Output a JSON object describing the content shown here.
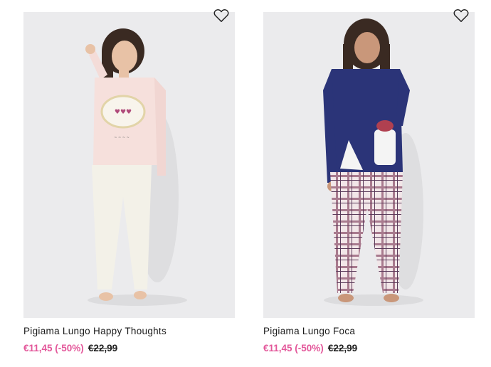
{
  "colors": {
    "sale_price": "#e3579a",
    "text": "#1a1a1a",
    "photo_bg": "#ebebed"
  },
  "products": [
    {
      "name": "Pigiama Lungo Happy Thoughts",
      "sale_price": "€11,45 (-50%)",
      "original_price": "€22,99",
      "wishlist_icon": "heart-outline-icon",
      "photo_alt": "pink pajama top with cloud and hearts, cream trousers"
    },
    {
      "name": "Pigiama Lungo Foca",
      "sale_price": "€11,45 (-50%)",
      "original_price": "€22,99",
      "wishlist_icon": "heart-outline-icon",
      "photo_alt": "navy pajama top with seal print, checked trousers"
    }
  ]
}
